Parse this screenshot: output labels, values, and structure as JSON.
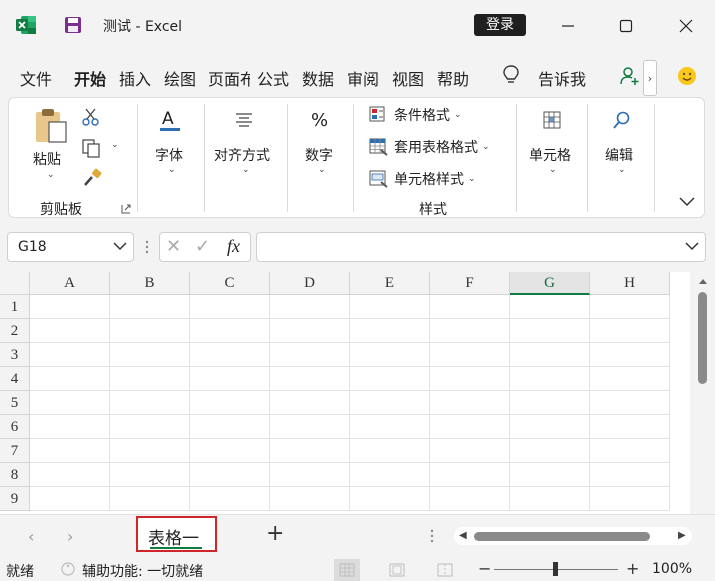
{
  "titlebar": {
    "title": "测试  -  Excel",
    "login": "登录"
  },
  "menu": {
    "tabs": [
      "文件",
      "开始",
      "插入",
      "绘图",
      "页面布",
      "公式",
      "数据",
      "审阅",
      "视图",
      "帮助"
    ],
    "active": "开始",
    "tell_me": "告诉我",
    "more": "›"
  },
  "ribbon": {
    "paste": "粘贴",
    "clipboard_group": "剪贴板",
    "font": "字体",
    "alignment": "对齐方式",
    "number": "数字",
    "number_symbol": "%",
    "conditional_format": "条件格式",
    "table_format": "套用表格格式",
    "cell_styles": "单元格样式",
    "styles_group": "样式",
    "cells": "单元格",
    "editing": "编辑"
  },
  "formula_bar": {
    "name_box": "G18",
    "fx": "fx",
    "cancel": "✕",
    "enter": "✓",
    "formula": ""
  },
  "grid": {
    "columns": [
      "A",
      "B",
      "C",
      "D",
      "E",
      "F",
      "G",
      "H"
    ],
    "selected_column": "G",
    "rows": [
      "1",
      "2",
      "3",
      "4",
      "5",
      "6",
      "7",
      "8",
      "9"
    ]
  },
  "sheets": {
    "tabs": [
      "表格一"
    ],
    "active": "表格一",
    "prev": "‹",
    "next": "›",
    "add": "+"
  },
  "status": {
    "ready": "就绪",
    "accessibility": "辅助功能: 一切就绪",
    "zoom_minus": "−",
    "zoom_plus": "+",
    "zoom": "100%",
    "zoom_fraction": 0.5
  },
  "colors": {
    "excel_green": "#107c41",
    "highlight_red": "#d0262b"
  }
}
